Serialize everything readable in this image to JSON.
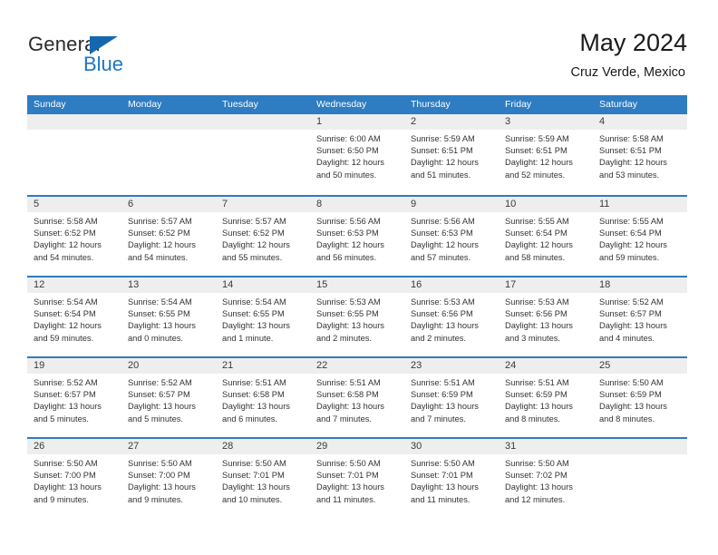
{
  "branding": {
    "name_part1": "General",
    "name_part2": "Blue",
    "triangle_icon": "triangle-icon",
    "accent_color": "#1b76c4",
    "logo_dark_color": "#2b2b2b"
  },
  "header": {
    "title": "May 2024",
    "location": "Cruz Verde, Mexico"
  },
  "calendar": {
    "header_bg": "#2e7cc1",
    "band_bg": "#eeeeee",
    "weekdays": [
      "Sunday",
      "Monday",
      "Tuesday",
      "Wednesday",
      "Thursday",
      "Friday",
      "Saturday"
    ],
    "weeks": [
      [
        {
          "empty": true
        },
        {
          "empty": true
        },
        {
          "empty": true
        },
        {
          "day": "1",
          "sunrise": "Sunrise: 6:00 AM",
          "sunset": "Sunset: 6:50 PM",
          "daylight_line1": "Daylight: 12 hours",
          "daylight_line2": "and 50 minutes."
        },
        {
          "day": "2",
          "sunrise": "Sunrise: 5:59 AM",
          "sunset": "Sunset: 6:51 PM",
          "daylight_line1": "Daylight: 12 hours",
          "daylight_line2": "and 51 minutes."
        },
        {
          "day": "3",
          "sunrise": "Sunrise: 5:59 AM",
          "sunset": "Sunset: 6:51 PM",
          "daylight_line1": "Daylight: 12 hours",
          "daylight_line2": "and 52 minutes."
        },
        {
          "day": "4",
          "sunrise": "Sunrise: 5:58 AM",
          "sunset": "Sunset: 6:51 PM",
          "daylight_line1": "Daylight: 12 hours",
          "daylight_line2": "and 53 minutes."
        }
      ],
      [
        {
          "day": "5",
          "sunrise": "Sunrise: 5:58 AM",
          "sunset": "Sunset: 6:52 PM",
          "daylight_line1": "Daylight: 12 hours",
          "daylight_line2": "and 54 minutes."
        },
        {
          "day": "6",
          "sunrise": "Sunrise: 5:57 AM",
          "sunset": "Sunset: 6:52 PM",
          "daylight_line1": "Daylight: 12 hours",
          "daylight_line2": "and 54 minutes."
        },
        {
          "day": "7",
          "sunrise": "Sunrise: 5:57 AM",
          "sunset": "Sunset: 6:52 PM",
          "daylight_line1": "Daylight: 12 hours",
          "daylight_line2": "and 55 minutes."
        },
        {
          "day": "8",
          "sunrise": "Sunrise: 5:56 AM",
          "sunset": "Sunset: 6:53 PM",
          "daylight_line1": "Daylight: 12 hours",
          "daylight_line2": "and 56 minutes."
        },
        {
          "day": "9",
          "sunrise": "Sunrise: 5:56 AM",
          "sunset": "Sunset: 6:53 PM",
          "daylight_line1": "Daylight: 12 hours",
          "daylight_line2": "and 57 minutes."
        },
        {
          "day": "10",
          "sunrise": "Sunrise: 5:55 AM",
          "sunset": "Sunset: 6:54 PM",
          "daylight_line1": "Daylight: 12 hours",
          "daylight_line2": "and 58 minutes."
        },
        {
          "day": "11",
          "sunrise": "Sunrise: 5:55 AM",
          "sunset": "Sunset: 6:54 PM",
          "daylight_line1": "Daylight: 12 hours",
          "daylight_line2": "and 59 minutes."
        }
      ],
      [
        {
          "day": "12",
          "sunrise": "Sunrise: 5:54 AM",
          "sunset": "Sunset: 6:54 PM",
          "daylight_line1": "Daylight: 12 hours",
          "daylight_line2": "and 59 minutes."
        },
        {
          "day": "13",
          "sunrise": "Sunrise: 5:54 AM",
          "sunset": "Sunset: 6:55 PM",
          "daylight_line1": "Daylight: 13 hours",
          "daylight_line2": "and 0 minutes."
        },
        {
          "day": "14",
          "sunrise": "Sunrise: 5:54 AM",
          "sunset": "Sunset: 6:55 PM",
          "daylight_line1": "Daylight: 13 hours",
          "daylight_line2": "and 1 minute."
        },
        {
          "day": "15",
          "sunrise": "Sunrise: 5:53 AM",
          "sunset": "Sunset: 6:55 PM",
          "daylight_line1": "Daylight: 13 hours",
          "daylight_line2": "and 2 minutes."
        },
        {
          "day": "16",
          "sunrise": "Sunrise: 5:53 AM",
          "sunset": "Sunset: 6:56 PM",
          "daylight_line1": "Daylight: 13 hours",
          "daylight_line2": "and 2 minutes."
        },
        {
          "day": "17",
          "sunrise": "Sunrise: 5:53 AM",
          "sunset": "Sunset: 6:56 PM",
          "daylight_line1": "Daylight: 13 hours",
          "daylight_line2": "and 3 minutes."
        },
        {
          "day": "18",
          "sunrise": "Sunrise: 5:52 AM",
          "sunset": "Sunset: 6:57 PM",
          "daylight_line1": "Daylight: 13 hours",
          "daylight_line2": "and 4 minutes."
        }
      ],
      [
        {
          "day": "19",
          "sunrise": "Sunrise: 5:52 AM",
          "sunset": "Sunset: 6:57 PM",
          "daylight_line1": "Daylight: 13 hours",
          "daylight_line2": "and 5 minutes."
        },
        {
          "day": "20",
          "sunrise": "Sunrise: 5:52 AM",
          "sunset": "Sunset: 6:57 PM",
          "daylight_line1": "Daylight: 13 hours",
          "daylight_line2": "and 5 minutes."
        },
        {
          "day": "21",
          "sunrise": "Sunrise: 5:51 AM",
          "sunset": "Sunset: 6:58 PM",
          "daylight_line1": "Daylight: 13 hours",
          "daylight_line2": "and 6 minutes."
        },
        {
          "day": "22",
          "sunrise": "Sunrise: 5:51 AM",
          "sunset": "Sunset: 6:58 PM",
          "daylight_line1": "Daylight: 13 hours",
          "daylight_line2": "and 7 minutes."
        },
        {
          "day": "23",
          "sunrise": "Sunrise: 5:51 AM",
          "sunset": "Sunset: 6:59 PM",
          "daylight_line1": "Daylight: 13 hours",
          "daylight_line2": "and 7 minutes."
        },
        {
          "day": "24",
          "sunrise": "Sunrise: 5:51 AM",
          "sunset": "Sunset: 6:59 PM",
          "daylight_line1": "Daylight: 13 hours",
          "daylight_line2": "and 8 minutes."
        },
        {
          "day": "25",
          "sunrise": "Sunrise: 5:50 AM",
          "sunset": "Sunset: 6:59 PM",
          "daylight_line1": "Daylight: 13 hours",
          "daylight_line2": "and 8 minutes."
        }
      ],
      [
        {
          "day": "26",
          "sunrise": "Sunrise: 5:50 AM",
          "sunset": "Sunset: 7:00 PM",
          "daylight_line1": "Daylight: 13 hours",
          "daylight_line2": "and 9 minutes."
        },
        {
          "day": "27",
          "sunrise": "Sunrise: 5:50 AM",
          "sunset": "Sunset: 7:00 PM",
          "daylight_line1": "Daylight: 13 hours",
          "daylight_line2": "and 9 minutes."
        },
        {
          "day": "28",
          "sunrise": "Sunrise: 5:50 AM",
          "sunset": "Sunset: 7:01 PM",
          "daylight_line1": "Daylight: 13 hours",
          "daylight_line2": "and 10 minutes."
        },
        {
          "day": "29",
          "sunrise": "Sunrise: 5:50 AM",
          "sunset": "Sunset: 7:01 PM",
          "daylight_line1": "Daylight: 13 hours",
          "daylight_line2": "and 11 minutes."
        },
        {
          "day": "30",
          "sunrise": "Sunrise: 5:50 AM",
          "sunset": "Sunset: 7:01 PM",
          "daylight_line1": "Daylight: 13 hours",
          "daylight_line2": "and 11 minutes."
        },
        {
          "day": "31",
          "sunrise": "Sunrise: 5:50 AM",
          "sunset": "Sunset: 7:02 PM",
          "daylight_line1": "Daylight: 13 hours",
          "daylight_line2": "and 12 minutes."
        },
        {
          "empty": true
        }
      ]
    ]
  }
}
